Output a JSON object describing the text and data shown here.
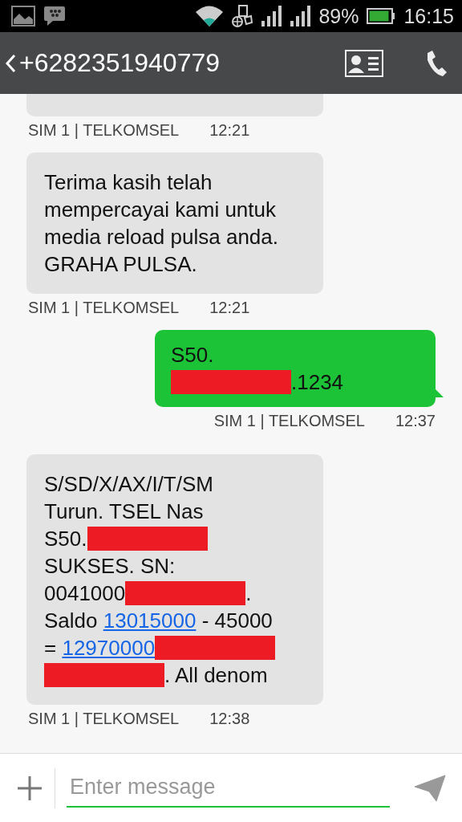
{
  "status_bar": {
    "battery": "89%",
    "time": "16:15"
  },
  "header": {
    "title": "+6282351940779"
  },
  "messages": [
    {
      "kind": "incoming_cut_off",
      "sim": "SIM 1 |  TELKOMSEL",
      "time": "12:21"
    },
    {
      "kind": "incoming",
      "lines": [
        [
          {
            "kind": "text",
            "text": "Terima kasih telah"
          }
        ],
        [
          {
            "kind": "text",
            "text": "mempercayai kami untuk"
          }
        ],
        [
          {
            "kind": "text",
            "text": "media reload pulsa anda."
          }
        ],
        [
          {
            "kind": "text",
            "text": "GRAHA PULSA."
          }
        ]
      ],
      "sim": "SIM 1 |  TELKOMSEL",
      "time": "12:21"
    },
    {
      "kind": "outgoing",
      "lines": [
        [
          {
            "kind": "text",
            "text": "S50."
          }
        ],
        [
          {
            "kind": "redacted"
          },
          {
            "kind": "text",
            "text": ".1234"
          }
        ]
      ],
      "sim": "SIM 1 |  TELKOMSEL",
      "time": "12:37"
    },
    {
      "kind": "incoming",
      "lines": [
        [
          {
            "kind": "text",
            "text": "S/SD/X/AX/I/T/SM"
          }
        ],
        [
          {
            "kind": "text",
            "text": "Turun. TSEL Nas"
          }
        ],
        [
          {
            "kind": "text",
            "text": "S50."
          },
          {
            "kind": "redacted"
          }
        ],
        [
          {
            "kind": "text",
            "text": "SUKSES. SN:"
          }
        ],
        [
          {
            "kind": "text",
            "text": "0041000"
          },
          {
            "kind": "redacted"
          },
          {
            "kind": "text",
            "text": "."
          }
        ],
        [
          {
            "kind": "text",
            "text": "Saldo "
          },
          {
            "kind": "link",
            "text": "13015000"
          },
          {
            "kind": "text",
            "text": " - 45000"
          }
        ],
        [
          {
            "kind": "text",
            "text": "= "
          },
          {
            "kind": "link",
            "text": "12970000"
          },
          {
            "kind": "redacted"
          }
        ],
        [
          {
            "kind": "redacted"
          },
          {
            "kind": "text",
            "text": ". All denom"
          }
        ]
      ],
      "sim": "SIM 1 |  TELKOMSEL",
      "time": "12:38"
    }
  ],
  "composer": {
    "placeholder": "Enter message"
  }
}
